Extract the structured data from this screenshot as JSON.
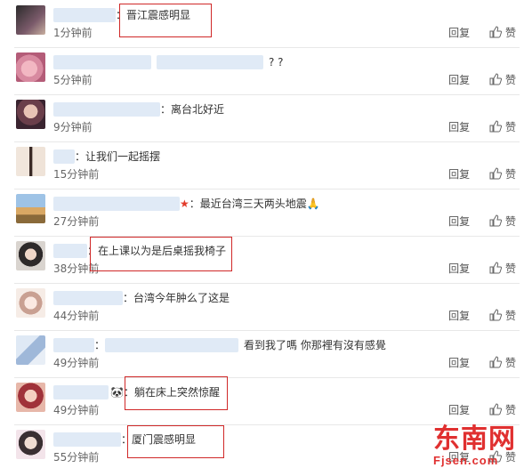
{
  "comments": [
    {
      "text": "晋江震感明显",
      "time": "1分钟前",
      "emoji": ""
    },
    {
      "text": "? ?",
      "time": "5分钟前",
      "emoji": ""
    },
    {
      "text": "离台北好近",
      "time": "9分钟前",
      "emoji": ""
    },
    {
      "text": "让我们一起摇摆",
      "time": "15分钟前",
      "emoji": ""
    },
    {
      "text": "最近台湾三天两头地震🙏",
      "time": "27分钟前",
      "emoji": "★"
    },
    {
      "text": "在上课以为是后桌摇我椅子",
      "time": "38分钟前",
      "emoji": ""
    },
    {
      "text": "台湾今年肿么了这是",
      "time": "44分钟前",
      "emoji": ""
    },
    {
      "text": "看到我了嗎 你那裡有沒有感覺",
      "time": "49分钟前",
      "emoji": ""
    },
    {
      "text": "躺在床上突然惊醒",
      "time": "49分钟前",
      "emoji": "🐼"
    },
    {
      "text": "厦门震感明显",
      "time": "55分钟前",
      "emoji": ""
    }
  ],
  "actions": {
    "reply_label": "回复",
    "like_label": "赞"
  },
  "watermark": {
    "name": "东南网",
    "url": "Fjsen.com"
  },
  "colors": {
    "highlight_box": "#d02828",
    "watermark": "#e03030"
  }
}
